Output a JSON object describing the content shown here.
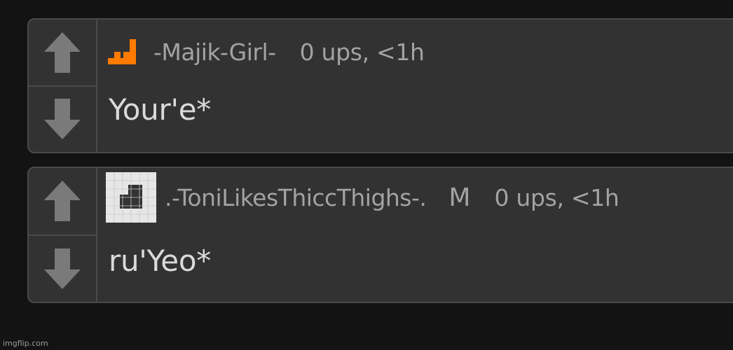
{
  "comments": [
    {
      "username": "-Majik-Girl-",
      "badge": "",
      "points": "0 ups, <1h",
      "text": "Your'e*",
      "avatar_icon": "orange-pixel-avatar-icon",
      "avatar_color": "#ff7a00"
    },
    {
      "username": ".-ToniLikesThiccThighs-.",
      "badge": "M",
      "points": "0 ups, <1h",
      "text": "ru'Yeo*",
      "avatar_icon": "white-pixel-avatar-icon",
      "avatar_color": "#e6e6e6"
    }
  ],
  "vote_icons": {
    "up": "upvote-arrow-icon",
    "down": "downvote-arrow-icon",
    "color": "#7a7a7a"
  },
  "watermark": "imgflip.com"
}
